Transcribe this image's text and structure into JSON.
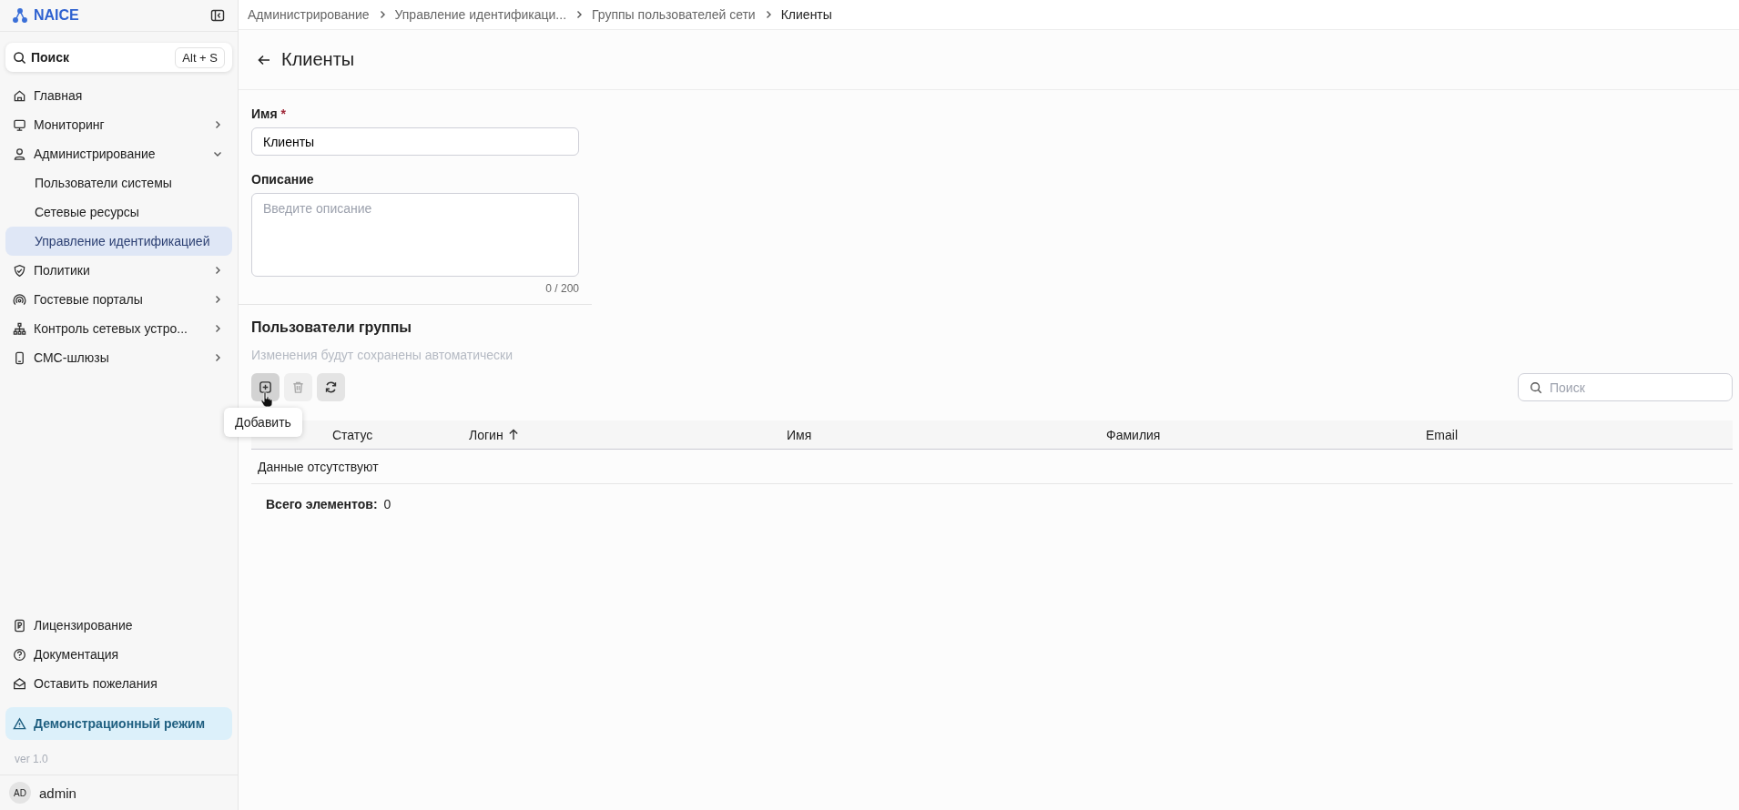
{
  "sidebar": {
    "logo": "NAICE",
    "search": {
      "label": "Поиск",
      "shortcut": "Alt + S"
    },
    "items": [
      {
        "label": "Главная"
      },
      {
        "label": "Мониторинг",
        "expanded": false
      },
      {
        "label": "Администрирование",
        "expanded": true,
        "children": [
          {
            "label": "Пользователи системы",
            "selected": false
          },
          {
            "label": "Сетевые ресурсы",
            "selected": false
          },
          {
            "label": "Управление идентификацией",
            "selected": true
          }
        ]
      },
      {
        "label": "Политики",
        "expanded": false
      },
      {
        "label": "Гостевые порталы",
        "expanded": false
      },
      {
        "label": "Контроль сетевых устро...",
        "expanded": false
      },
      {
        "label": "СМС-шлюзы",
        "expanded": false
      }
    ],
    "bottom_items": [
      "Лицензирование",
      "Документация",
      "Оставить пожелания"
    ],
    "demo_banner": "Демонстрационный режим",
    "version": "ver 1.0",
    "user": {
      "initials": "AD",
      "name": "admin"
    }
  },
  "breadcrumbs": [
    "Администрирование",
    "Управление идентификаци...",
    "Группы пользователей сети",
    "Клиенты"
  ],
  "page_title": "Клиенты",
  "form": {
    "name": {
      "label": "Имя",
      "required_mark": "*",
      "value": "Клиенты"
    },
    "description": {
      "label": "Описание",
      "placeholder": "Введите описание",
      "counter": "0 / 200"
    }
  },
  "group_users": {
    "title": "Пользователи группы",
    "note": "Изменения будут сохранены автоматически",
    "toolbar": [
      {
        "kind": "add",
        "disabled": false,
        "hovered": true
      },
      {
        "kind": "delete",
        "disabled": true,
        "hovered": false
      },
      {
        "kind": "refresh",
        "disabled": false,
        "hovered": false
      }
    ],
    "tooltip": "Добавить",
    "search": {
      "placeholder": "Поиск"
    },
    "table": {
      "columns": [
        {
          "label": "Статус",
          "sorted": false
        },
        {
          "label": "Логин",
          "sorted": true
        },
        {
          "label": "Имя",
          "sorted": false
        },
        {
          "label": "Фамилия",
          "sorted": false
        },
        {
          "label": "Email",
          "sorted": false
        }
      ],
      "empty_text": "Данные отсутствуют"
    },
    "total": {
      "label": "Всего элементов:",
      "value": "0"
    }
  }
}
